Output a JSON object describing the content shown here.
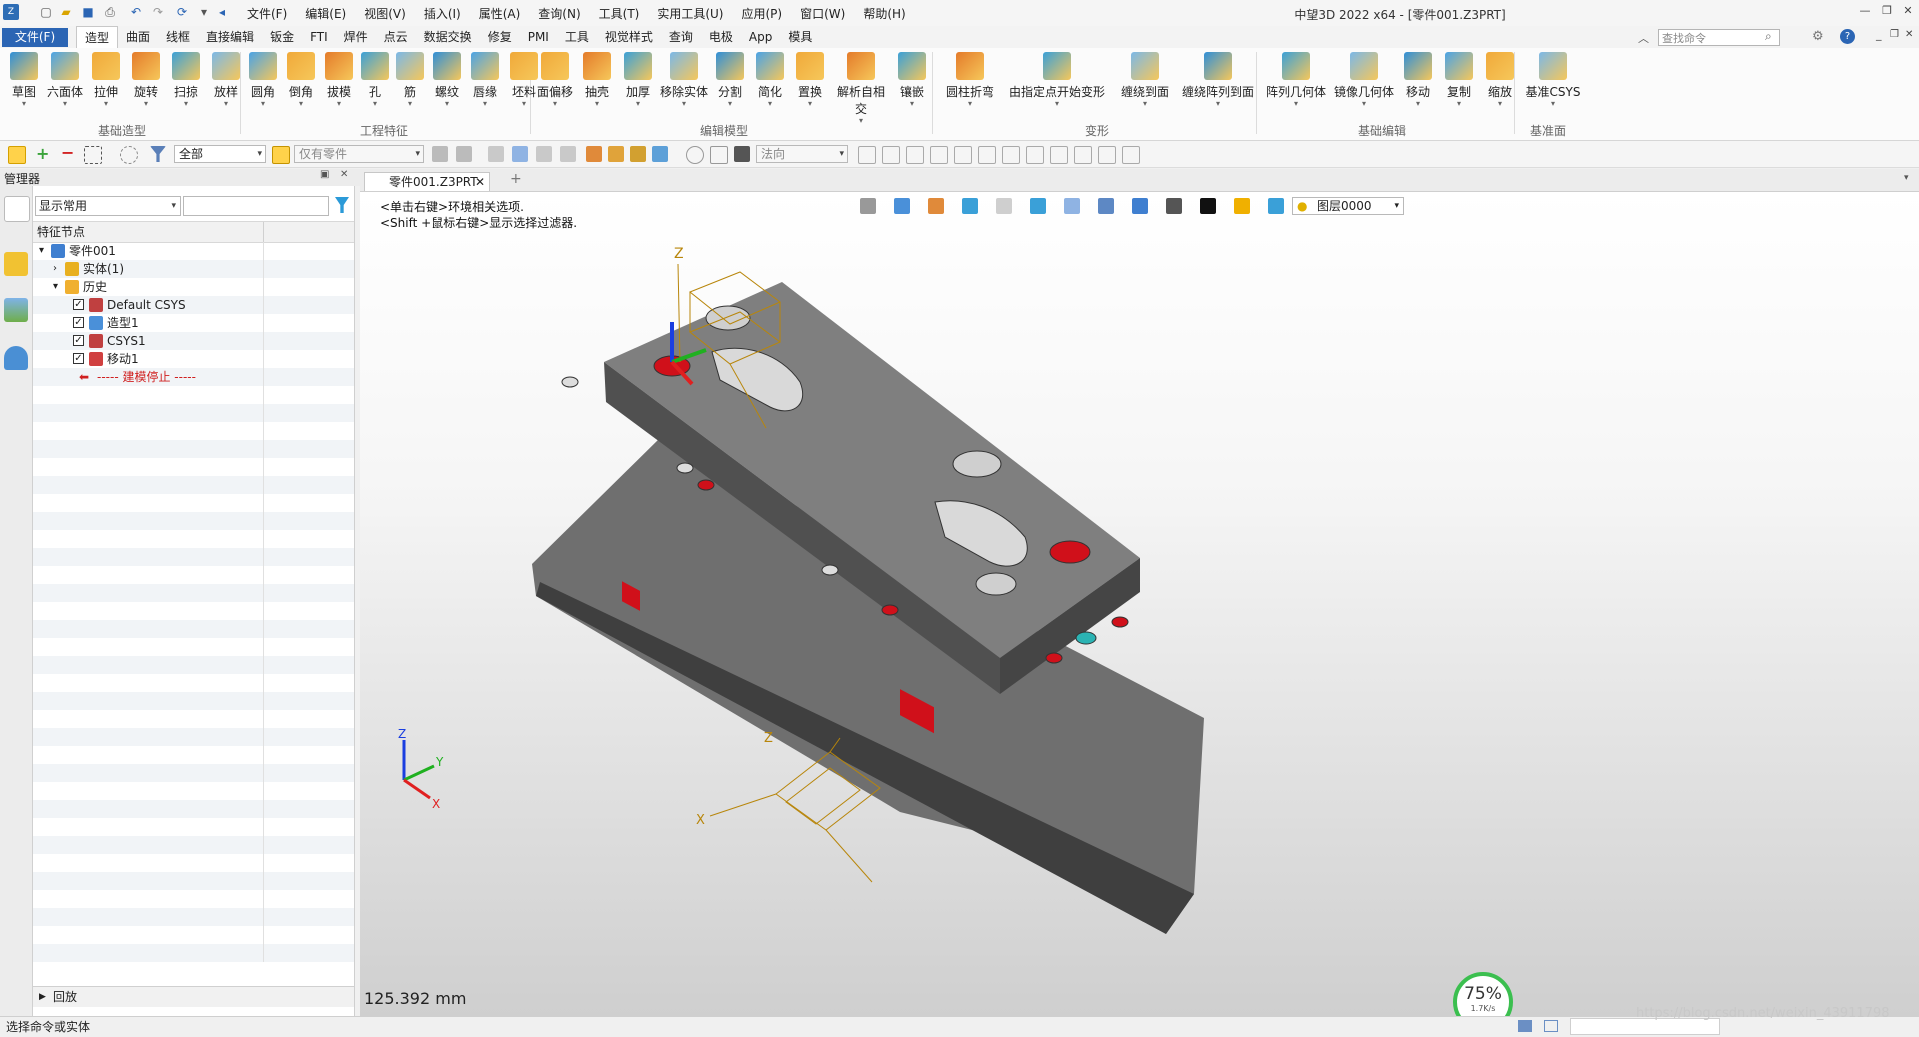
{
  "titlebar": {
    "app_title": "中望3D 2022 x64 - [零件001.Z3PRT]",
    "menus": [
      "文件(F)",
      "编辑(E)",
      "视图(V)",
      "插入(I)",
      "属性(A)",
      "查询(N)",
      "工具(T)",
      "实用工具(U)",
      "应用(P)",
      "窗口(W)",
      "帮助(H)"
    ]
  },
  "tabs": {
    "file_tab": "文件(F)",
    "items": [
      "造型",
      "曲面",
      "线框",
      "直接编辑",
      "钣金",
      "FTI",
      "焊件",
      "点云",
      "数据交换",
      "修复",
      "PMI",
      "工具",
      "视觉样式",
      "查询",
      "电极",
      "App",
      "模具"
    ],
    "active": "造型"
  },
  "search": {
    "placeholder": "查找命令"
  },
  "ribbon": {
    "groups": [
      {
        "label": "基础造型",
        "buttons": [
          "草图",
          "六面体",
          "拉伸",
          "旋转",
          "扫掠",
          "放样"
        ]
      },
      {
        "label": "工程特征",
        "buttons": [
          "圆角",
          "倒角",
          "拔模",
          "孔",
          "筋",
          "螺纹",
          "唇缘",
          "坯料"
        ]
      },
      {
        "label": "编辑模型",
        "buttons": [
          "面偏移",
          "抽壳",
          "加厚",
          "移除实体",
          "分割",
          "简化",
          "置换",
          "解析自相交",
          "镶嵌"
        ]
      },
      {
        "label": "变形",
        "buttons": [
          "圆柱折弯",
          "由指定点开始变形",
          "缠绕到面",
          "缠绕阵列到面"
        ]
      },
      {
        "label": "基础编辑",
        "buttons": [
          "阵列几何体",
          "镜像几何体",
          "移动",
          "复制",
          "缩放"
        ]
      },
      {
        "label": "基准面",
        "buttons": [
          "基准CSYS"
        ]
      }
    ]
  },
  "toolbar": {
    "filter_value": "全部",
    "scope_value": "仅有零件",
    "direction_value": "法向"
  },
  "manager": {
    "title": "管理器",
    "display_select": "显示常用",
    "tree_header": "特征节点",
    "tree": [
      {
        "label": "零件001",
        "indent": 0,
        "expand": "▾",
        "checked": null
      },
      {
        "label": "实体(1)",
        "indent": 1,
        "expand": "›",
        "checked": null
      },
      {
        "label": "历史",
        "indent": 1,
        "expand": "▾",
        "checked": null
      },
      {
        "label": "Default CSYS",
        "indent": 2,
        "expand": "",
        "checked": true
      },
      {
        "label": "造型1",
        "indent": 2,
        "expand": "",
        "checked": true
      },
      {
        "label": "CSYS1",
        "indent": 2,
        "expand": "",
        "checked": true
      },
      {
        "label": "移动1",
        "indent": 2,
        "expand": "",
        "checked": true
      },
      {
        "label": "----- 建模停止 -----",
        "indent": 2,
        "expand": "",
        "checked": null,
        "stop": true
      }
    ],
    "playback": "回放"
  },
  "document": {
    "tab_label": "零件001.Z3PRT",
    "hint_line1": "<单击右键>环境相关选项.",
    "hint_line2": "<Shift +鼠标右键>显示选择过滤器.",
    "layer": "图层0000",
    "scale_readout": "125.392 mm"
  },
  "axis_labels": {
    "z": "Z",
    "x": "X",
    "y": "Y"
  },
  "status": {
    "prompt": "选择命令或实体",
    "perf_percent": "75%",
    "perf_rate": "1.7K/s",
    "watermark": "https://blog.csdn.net/weixin_43911798"
  },
  "colors": {
    "file_tab_bg": "#2b65b4",
    "part_gray": "#7f7f7f",
    "hole_red": "#d0101a",
    "csys_orange": "#b8860b",
    "perf_green": "#3bbf4f"
  }
}
